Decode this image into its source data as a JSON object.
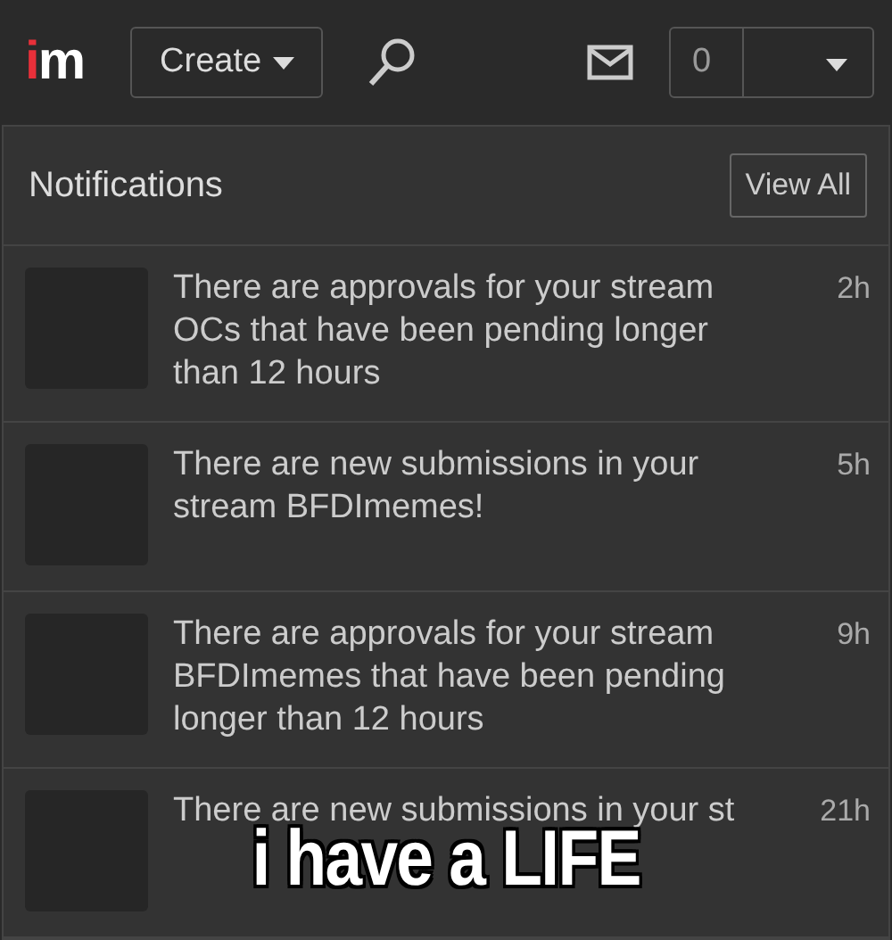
{
  "header": {
    "logo": "im",
    "create_button": "Create",
    "notification_count": "0"
  },
  "notifications": {
    "title": "Notifications",
    "view_all": "View All",
    "items": [
      {
        "text": "There are approvals for your stream OCs that have been pending longer than 12 hours",
        "time": "2h"
      },
      {
        "text": "There are new submissions in your stream BFDImemes!",
        "time": "5h"
      },
      {
        "text": "There are approvals for your stream BFDImemes that have been pending longer than 12 hours",
        "time": "9h"
      },
      {
        "text": "There are new submissions in your st",
        "time": "21h"
      }
    ]
  },
  "caption": "i have a LIFE"
}
